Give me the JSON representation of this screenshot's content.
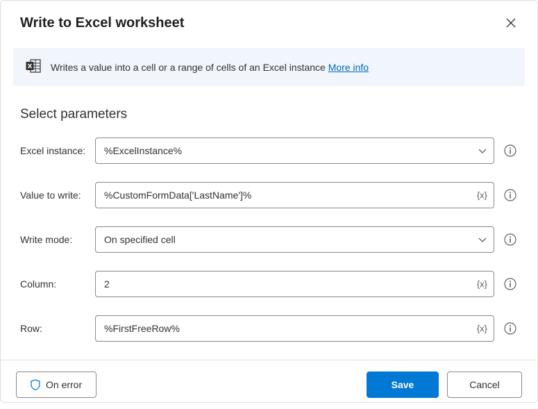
{
  "header": {
    "title": "Write to Excel worksheet"
  },
  "description": {
    "text": "Writes a value into a cell or a range of cells of an Excel instance ",
    "more_label": "More info"
  },
  "section_title": "Select parameters",
  "fields": {
    "excel_instance": {
      "label": "Excel instance:",
      "value": "%ExcelInstance%"
    },
    "value_to_write": {
      "label": "Value to write:",
      "value": "%CustomFormData['LastName']%"
    },
    "write_mode": {
      "label": "Write mode:",
      "value": "On specified cell"
    },
    "column": {
      "label": "Column:",
      "value": "2"
    },
    "row": {
      "label": "Row:",
      "value": "%FirstFreeRow%"
    }
  },
  "footer": {
    "on_error": "On error",
    "save": "Save",
    "cancel": "Cancel"
  }
}
